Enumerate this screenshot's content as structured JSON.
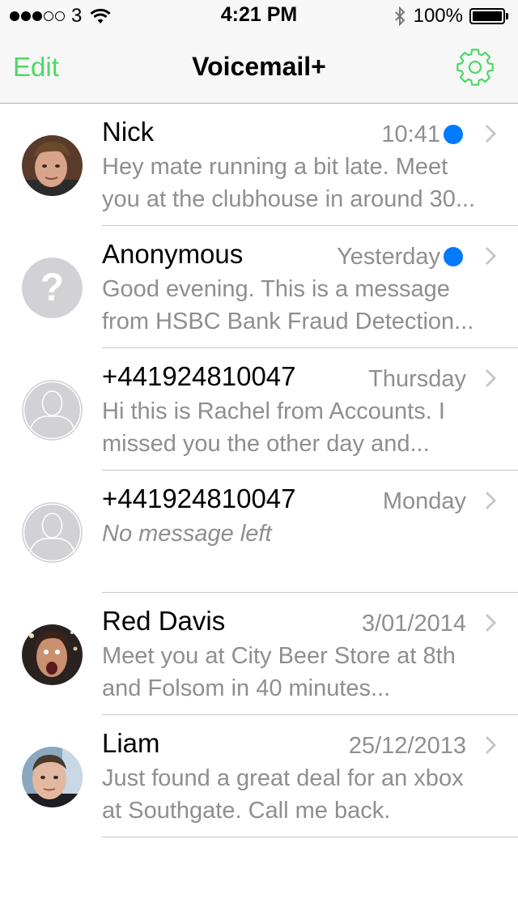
{
  "status_bar": {
    "carrier": "3",
    "time": "4:21 PM",
    "battery": "100%",
    "signal_bars_filled": 3,
    "signal_bars_total": 5
  },
  "nav": {
    "edit_label": "Edit",
    "title": "Voicemail+",
    "accent_color": "#4cd964"
  },
  "voicemails": [
    {
      "name": "Nick",
      "date": "10:41",
      "unread": true,
      "avatar": "photo",
      "line1": "Hey mate running a bit late. Meet",
      "line2": "you at the clubhouse in around 30..."
    },
    {
      "name": "Anonymous",
      "date": "Yesterday",
      "unread": true,
      "avatar": "unknown-caller",
      "line1": "Good evening. This is a message",
      "line2": "from HSBC Bank Fraud Detection..."
    },
    {
      "name": "+441924810047",
      "date": "Thursday",
      "unread": false,
      "avatar": "placeholder-person",
      "line1": "Hi this is Rachel from Accounts. I",
      "line2": "missed you the other day and..."
    },
    {
      "name": "+441924810047",
      "date": "Monday",
      "unread": false,
      "avatar": "placeholder-person",
      "line1": "No message left",
      "line2": ""
    },
    {
      "name": "Red Davis",
      "date": "3/01/2014",
      "unread": false,
      "avatar": "photo",
      "line1": "Meet you at City Beer Store at 8th",
      "line2": "and Folsom in 40 minutes..."
    },
    {
      "name": "Liam",
      "date": "25/12/2013",
      "unread": false,
      "avatar": "photo",
      "line1": "Just found a great deal for an xbox",
      "line2": "at Southgate. Call me back."
    }
  ],
  "colors": {
    "unread_dot": "#007aff",
    "secondary_text": "#8e8e93",
    "separator": "#c8c7cc"
  }
}
